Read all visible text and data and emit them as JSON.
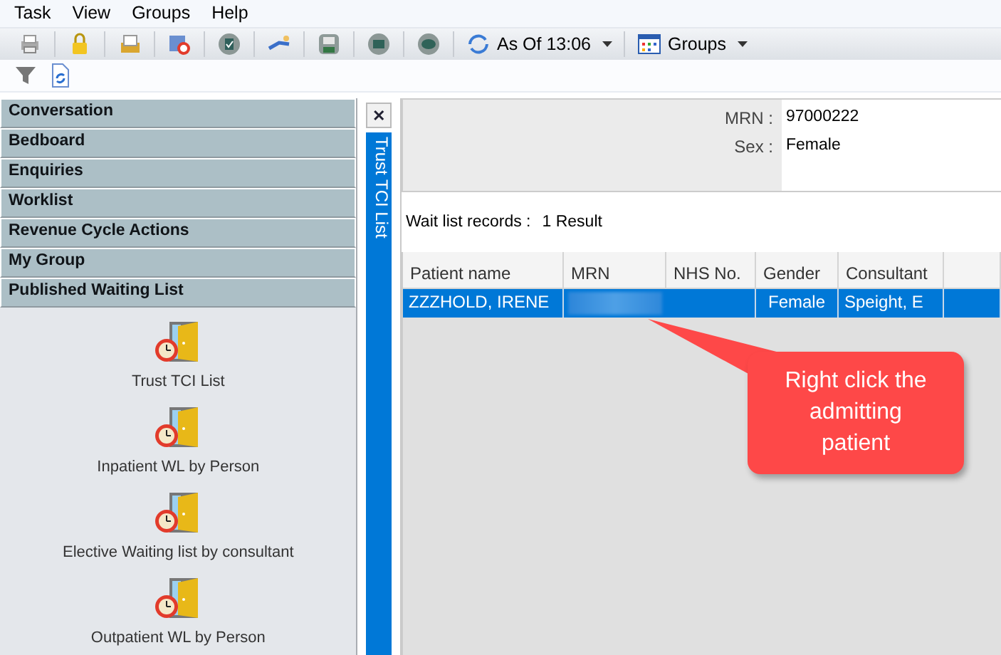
{
  "menu": [
    "Task",
    "View",
    "Groups",
    "Help"
  ],
  "toolbar": {
    "as_of": "As Of 13:06",
    "groups": "Groups"
  },
  "sidebar": {
    "sections": [
      {
        "label": "Conversation"
      },
      {
        "label": "Bedboard"
      },
      {
        "label": "Enquiries"
      },
      {
        "label": "Worklist"
      },
      {
        "label": "Revenue Cycle Actions"
      },
      {
        "label": "My Group"
      },
      {
        "label": "Published Waiting List",
        "items": [
          "Trust TCI List",
          "Inpatient WL by Person",
          "Elective Waiting list by consultant",
          "Outpatient WL by Person"
        ]
      }
    ]
  },
  "side_tab": {
    "label": "Trust TCI List",
    "close": "✕"
  },
  "details": [
    {
      "label": "MRN :",
      "value": "97000222"
    },
    {
      "label": "Sex :",
      "value": "Female"
    }
  ],
  "records": {
    "label": "Wait list records :",
    "count": "1 Result"
  },
  "table": {
    "columns": [
      "Patient name",
      "MRN",
      "NHS No.",
      "Gender",
      "Consultant"
    ],
    "rows": [
      {
        "selected": true,
        "cells": [
          {
            "kind": "text",
            "text": "ZZZHOLD, IRENE"
          },
          {
            "kind": "redacted"
          },
          {
            "kind": "blank"
          },
          {
            "kind": "text",
            "text": "Female"
          },
          {
            "kind": "text",
            "text": "Speight, E"
          }
        ]
      }
    ]
  },
  "callout": "Right click the admitting patient"
}
